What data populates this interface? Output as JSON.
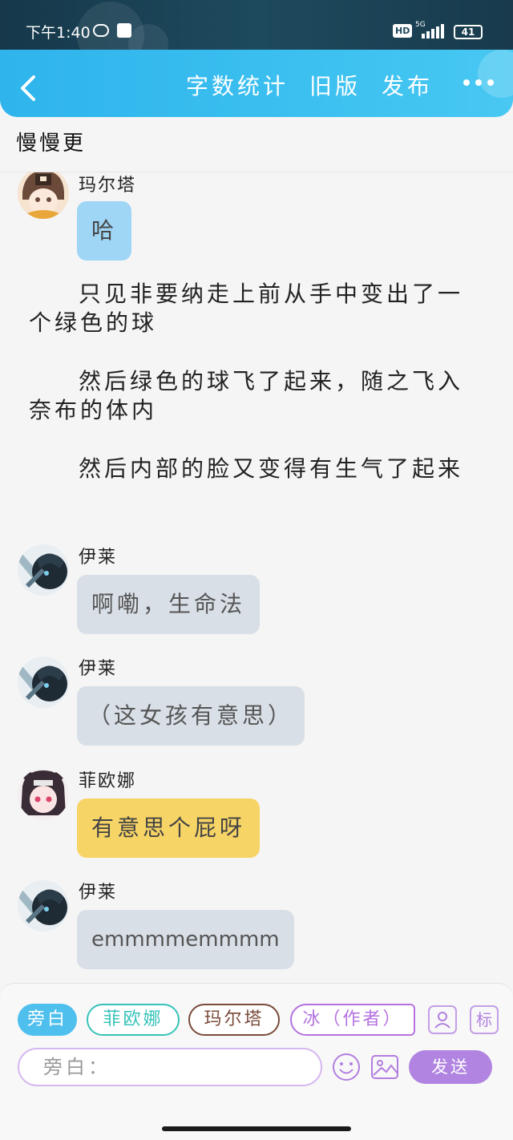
{
  "status": {
    "time": "下午1:40",
    "hd": "HD",
    "network": "5G",
    "battery": "41"
  },
  "header": {
    "actions": [
      "字数统计",
      "旧版",
      "发布"
    ],
    "more_icon": "more-icon",
    "back_icon": "back-icon"
  },
  "story": {
    "title": "慢慢更"
  },
  "messages": [
    {
      "type": "dialog",
      "speaker": "玛尔塔",
      "text": "哈",
      "color": "#9fd6f5"
    },
    {
      "type": "narration",
      "text": "只见非要纳走上前从手中变出了一个绿色的球"
    },
    {
      "type": "narration",
      "text": "然后绿色的球飞了起来，随之飞入奈布的体内"
    },
    {
      "type": "narration",
      "text": "然后内部的脸又变得有生气了起来"
    },
    {
      "type": "dialog",
      "speaker": "伊莱",
      "text": "啊嘞，生命法",
      "color": "#d9dfe7"
    },
    {
      "type": "dialog",
      "speaker": "伊莱",
      "text": "（这女孩有意思）",
      "color": "#d9dfe7"
    },
    {
      "type": "dialog",
      "speaker": "菲欧娜",
      "text": "有意思个屁呀",
      "color": "#f7d466"
    },
    {
      "type": "dialog",
      "speaker": "伊莱",
      "text": "emmmmemmmm",
      "color": "#d9dfe7"
    }
  ],
  "composer": {
    "roles": [
      "旁白",
      "菲欧娜",
      "玛尔塔",
      "冰（作者）"
    ],
    "tag_button": "标",
    "input_placeholder": "旁白：",
    "send_label": "发送"
  },
  "colors": {
    "header": "#3cc0f0",
    "accent": "#b084e0"
  }
}
